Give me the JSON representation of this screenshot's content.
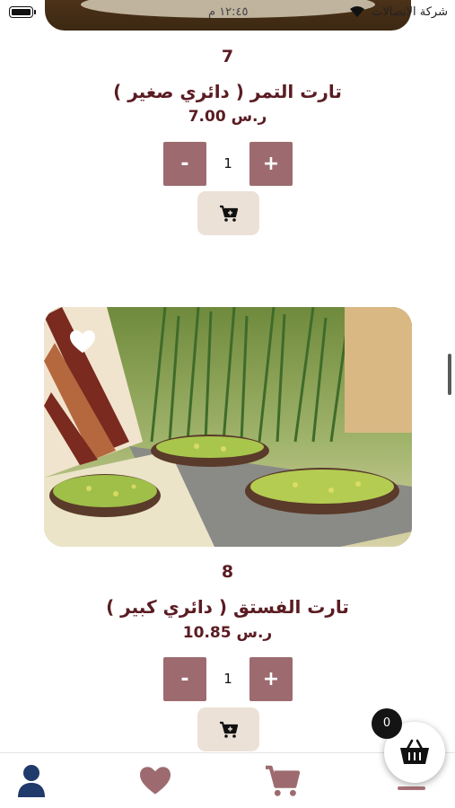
{
  "status_bar": {
    "carrier": "شركة الاتصالات",
    "time": "١٢:٤٥ م"
  },
  "products": [
    {
      "number": "7",
      "name": "تارت التمر ( دائري صغير )",
      "price": "ر.س 7.00",
      "quantity": "1",
      "minus_label": "-",
      "plus_label": "+"
    },
    {
      "number": "8",
      "name": "تارت الفستق ( دائري كبير )",
      "price": "ر.س 10.85",
      "quantity": "1",
      "minus_label": "-",
      "plus_label": "+",
      "favorite": false
    }
  ],
  "cart": {
    "count": "0"
  },
  "bottom_nav": {
    "items": [
      "profile-icon",
      "heart-icon",
      "cart-icon",
      "menu-icon"
    ]
  },
  "colors": {
    "accent": "#5a1c22",
    "button": "#9d6b6f",
    "cart_button_bg": "#ece1d6"
  }
}
